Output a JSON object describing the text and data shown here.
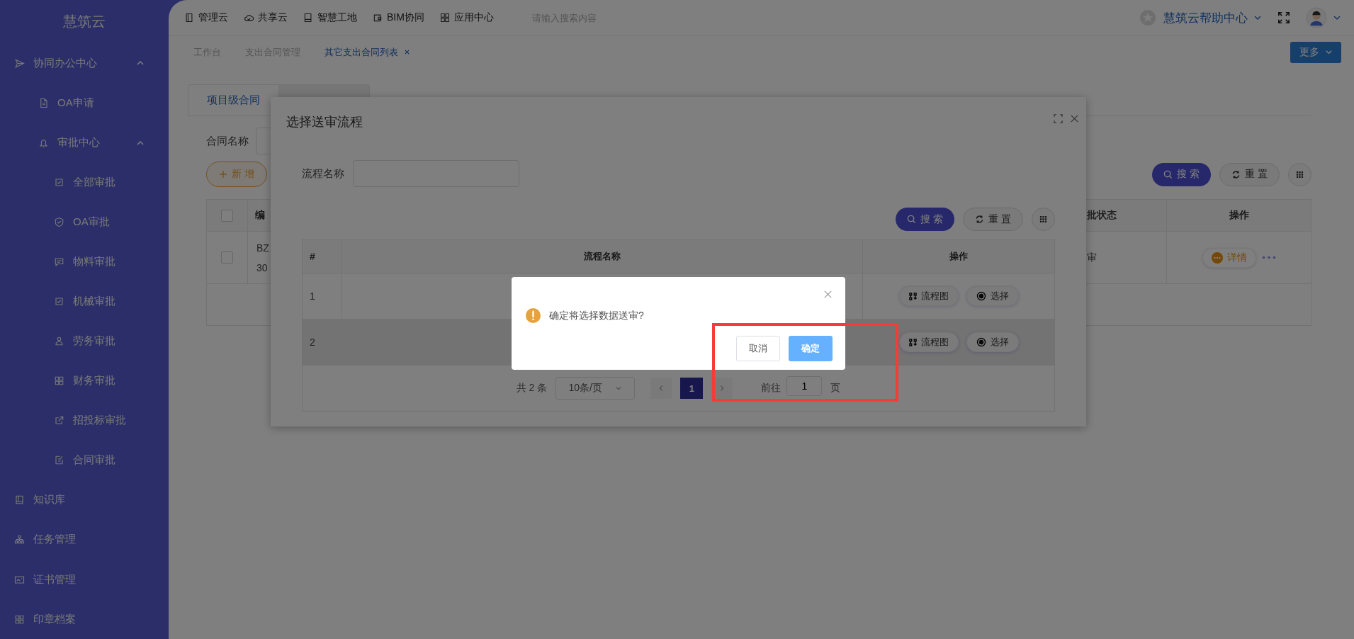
{
  "app": {
    "logo": "慧筑云"
  },
  "top_nav": {
    "items": [
      {
        "label": "管理云"
      },
      {
        "label": "共享云"
      },
      {
        "label": "智慧工地"
      },
      {
        "label": "BIM协同"
      },
      {
        "label": "应用中心"
      }
    ],
    "search": {
      "placeholder": "请输入搜索内容"
    },
    "help_center": "慧筑云帮助中心"
  },
  "page_tabs": [
    {
      "label": "工作台",
      "selected": false,
      "closable": false
    },
    {
      "label": "支出合同管理",
      "selected": false,
      "closable": false
    },
    {
      "label": "其它支出合同列表",
      "selected": true,
      "closable": true
    }
  ],
  "more_button": "更多",
  "sidebar": {
    "items": [
      {
        "label": "协同办公中心",
        "expanded": true,
        "children": [
          {
            "label": "OA申请"
          },
          {
            "label": "审批中心",
            "expanded": true,
            "children": [
              {
                "label": "全部审批"
              },
              {
                "label": "OA审批"
              },
              {
                "label": "物料审批"
              },
              {
                "label": "机械审批"
              },
              {
                "label": "劳务审批"
              },
              {
                "label": "财务审批"
              },
              {
                "label": "招投标审批"
              },
              {
                "label": "合同审批"
              }
            ]
          }
        ]
      },
      {
        "label": "知识库"
      },
      {
        "label": "任务管理"
      },
      {
        "label": "证书管理"
      },
      {
        "label": "印章档案"
      }
    ]
  },
  "content": {
    "tabs": [
      {
        "label": "项目级合同",
        "selected": true
      }
    ],
    "filter_label": "合同名称",
    "add_button": "新 增",
    "search_button": "搜 索",
    "reset_button": "重 置",
    "table": {
      "header_checked": false,
      "columns": [
        "编",
        "批状态",
        "操作"
      ],
      "rows": [
        {
          "checked": false,
          "code": [
            "BZ",
            "30"
          ],
          "status": "审",
          "action": "详情"
        }
      ]
    }
  },
  "dialog": {
    "title": "选择送审流程",
    "filter_label": "流程名称",
    "search_button": "搜 索",
    "reset_button": "重 置",
    "table": {
      "columns": [
        "#",
        "流程名称",
        "操作"
      ],
      "rows": [
        {
          "index": "1",
          "highlighted": false,
          "actions": [
            "流程图",
            "选择"
          ]
        },
        {
          "index": "2",
          "highlighted": true,
          "actions": [
            "流程图",
            "选择"
          ]
        }
      ]
    },
    "pagination": {
      "total": "共 2 条",
      "page_size": "10条/页",
      "pages": [
        {
          "label": "1",
          "selected": true
        }
      ],
      "goto_label": "前往",
      "goto_value": "1",
      "page_unit": "页"
    }
  },
  "confirm": {
    "message": "确定将选择数据送审?",
    "cancel_button": "取消",
    "ok_button": "确定"
  }
}
